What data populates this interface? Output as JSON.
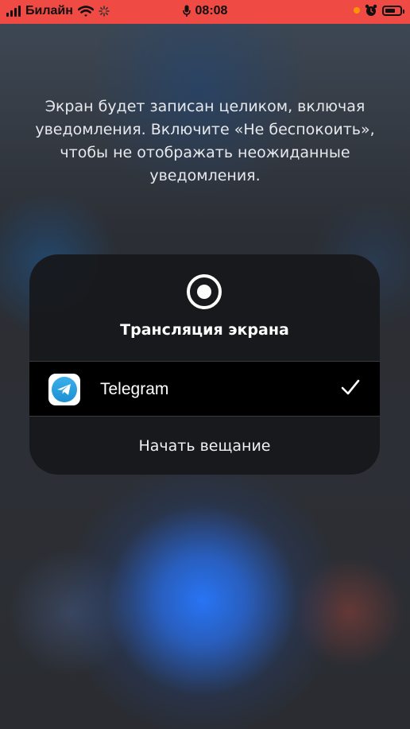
{
  "status_bar": {
    "carrier": "Билайн",
    "time": "08:08"
  },
  "message": "Экран будет записан целиком, включая уведомления. Включите «Не беспокоить», чтобы не отображать неожиданные уведомления.",
  "panel": {
    "title": "Трансляция экрана",
    "app_item": {
      "name": "Telegram",
      "icon": "telegram-icon",
      "selected": true
    },
    "start_button_label": "Начать вещание"
  },
  "colors": {
    "status_bar_bg": "#ef4a43",
    "panel_bg": "#17181b",
    "telegram_blue": "#2aa3e3"
  }
}
